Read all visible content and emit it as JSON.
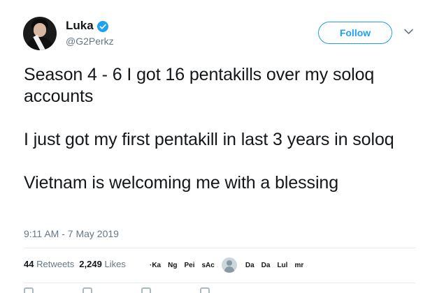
{
  "author": {
    "name": "Luka",
    "handle": "@G2Perkz",
    "verified": true
  },
  "actions": {
    "follow_label": "Follow"
  },
  "tweet": {
    "paragraphs": [
      "Season 4 - 6 I got 16 pentakills over my soloq accounts",
      "I just got my first pentakill in last 3 years in soloq",
      "Vietnam is welcoming me with a blessing"
    ],
    "timestamp": "9:11 AM - 7 May 2019"
  },
  "stats": {
    "retweets_count": "44",
    "retweets_label": "Retweets",
    "likes_count": "2,249",
    "likes_label": "Likes"
  },
  "likers": [
    "·Ka",
    "Ng",
    "Pei",
    "sAc",
    "Da",
    "Da",
    "Lul",
    "mr"
  ],
  "colors": {
    "accent": "#1da1f2",
    "text": "#14171a",
    "muted": "#657786",
    "divider": "#e6ecf0"
  },
  "icons": {
    "verified": "verified-badge-icon",
    "menu": "chevron-down-icon",
    "default_avatar": "default-avatar-icon"
  }
}
